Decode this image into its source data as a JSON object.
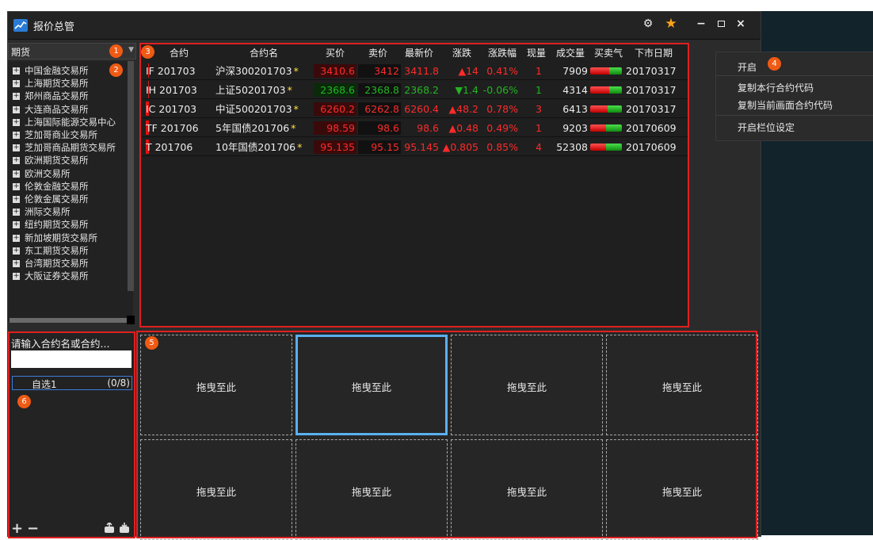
{
  "window": {
    "title": "报价总管",
    "settings_icon": "gear-icon",
    "favorite_icon": "star-icon",
    "min_icon": "minimize-icon",
    "max_icon": "maximize-icon",
    "close_icon": "close-icon"
  },
  "category": {
    "selected": "期货"
  },
  "exchanges": [
    "中国金融交易所",
    "上海期货交易所",
    "郑州商品交易所",
    "大连商品交易所",
    "上海国际能源交易中心",
    "芝加哥商业交易所",
    "芝加哥商品期货交易所",
    "欧洲期货交易所",
    "欧洲交易所",
    "伦敦金融交易所",
    "伦敦金属交易所",
    "洲际交易所",
    "纽约期货交易所",
    "新加坡期货交易所",
    "东工期货交易所",
    "台湾期货交易所",
    "大阪证券交易所"
  ],
  "table": {
    "headers": [
      "合约",
      "合约名",
      "买价",
      "卖价",
      "最新价",
      "涨跌",
      "涨跌幅",
      "现量",
      "成交量",
      "买卖气",
      "下市日期"
    ],
    "rows": [
      {
        "code": "IF 201703",
        "name": "沪深300201703",
        "bid": "3410.6",
        "ask": "3412",
        "last": "3411.8",
        "change": "▲14",
        "pct": "0.41%",
        "vol_now": "1",
        "volume": "7909",
        "expiry": "20170317",
        "dir": "up",
        "buy_pct": 0.6
      },
      {
        "code": "IH 201703",
        "name": "上证50201703",
        "bid": "2368.6",
        "ask": "2368.8",
        "last": "2368.2",
        "change": "▼1.4",
        "pct": "-0.06%",
        "vol_now": "1",
        "volume": "4314",
        "expiry": "20170317",
        "dir": "down",
        "buy_pct": 0.6
      },
      {
        "code": "IC 201703",
        "name": "中证500201703",
        "bid": "6260.2",
        "ask": "6262.8",
        "last": "6260.4",
        "change": "▲48.2",
        "pct": "0.78%",
        "vol_now": "3",
        "volume": "6413",
        "expiry": "20170317",
        "dir": "up",
        "buy_pct": 0.55
      },
      {
        "code": "TF 201706",
        "name": "5年国债201706",
        "bid": "98.59",
        "ask": "98.6",
        "last": "98.6",
        "change": "▲0.48",
        "pct": "0.49%",
        "vol_now": "1",
        "volume": "9203",
        "expiry": "20170609",
        "dir": "up",
        "buy_pct": 0.5
      },
      {
        "code": "T 201706",
        "name": "10年国债201706",
        "bid": "95.135",
        "ask": "95.15",
        "last": "95.145",
        "change": "▲0.805",
        "pct": "0.85%",
        "vol_now": "4",
        "volume": "52308",
        "expiry": "20170609",
        "dir": "up",
        "buy_pct": 0.5
      }
    ],
    "star": "*"
  },
  "context_menu": {
    "items": [
      "开启",
      "复制本行合约代码",
      "复制当前画面合约代码",
      "开启栏位设定"
    ]
  },
  "watchlist": {
    "placeholder": "请输入合约名或合约...",
    "search_value": "",
    "list_name": "自选1",
    "list_count": "(0/8)",
    "add": "+",
    "remove": "−"
  },
  "grid": {
    "cells": [
      "拖曳至此",
      "拖曳至此",
      "拖曳至此",
      "拖曳至此",
      "拖曳至此",
      "拖曳至此",
      "拖曳至此",
      "拖曳至此"
    ]
  },
  "badges": [
    "1",
    "2",
    "3",
    "4",
    "5",
    "6"
  ],
  "colors": {
    "up": "#ff2a2a",
    "down": "#22b622",
    "accent": "#ef5a14",
    "highlight": "#e02020",
    "select": "#5ab0f0"
  }
}
